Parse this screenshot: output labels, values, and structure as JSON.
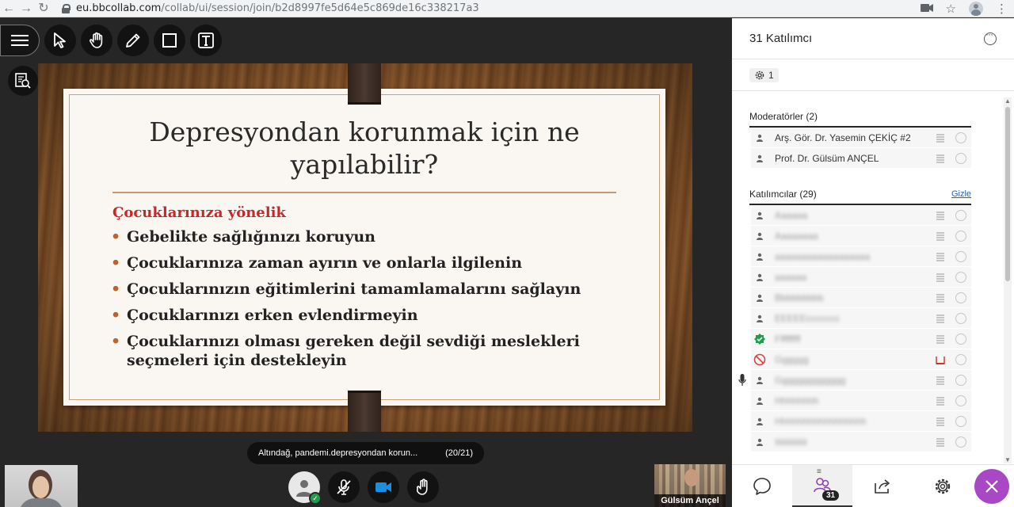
{
  "browser": {
    "url_domain": "eu.bbcollab.com",
    "url_path": "/collab/ui/session/join/b2d8997fe5d64e5c869de16c338217a3"
  },
  "slide": {
    "title": "Depresyondan korunmak için ne yapılabilir?",
    "subtitle": "Çocuklarınıza yönelik",
    "bullets": [
      "Gebelikte sağlığınızı koruyun",
      "Çocuklarınıza zaman ayırın ve onlarla ilgilenin",
      "Çocuklarınızın eğitimlerini tamamlamalarını sağlayın",
      "Çocuklarınızı erken evlendirmeyin",
      "Çocuklarınızı olması gereken değil sevdiği meslekleri seçmeleri için destekleyin"
    ]
  },
  "file": {
    "name": "Altındağ, pandemi.depresyondan korun...",
    "page": "(20/21)"
  },
  "speaker": {
    "name": "Gülsüm Ançel"
  },
  "panel": {
    "title": "31 Katılımcı",
    "filter_count": "1",
    "moderators_header": "Moderatörler (2)",
    "moderators": [
      "Arş. Gör. Dr. Yasemin ÇEKİÇ #2",
      "Prof. Dr. Gülsüm ANÇEL"
    ],
    "participants_header": "Katılımcılar (29)",
    "hide_label": "Gizle",
    "participants": [
      {
        "name": "Aaaaaa",
        "status": "person"
      },
      {
        "name": "Aaaaaaaa",
        "status": "person"
      },
      {
        "name": "aaaaaaaaaaaaaaaaaa",
        "status": "person"
      },
      {
        "name": "aaaaaa",
        "status": "person"
      },
      {
        "name": "Bbbbbbbbb",
        "status": "person"
      },
      {
        "name": "EEEEEccccccc",
        "status": "person"
      },
      {
        "name": "Fffffffff",
        "status": "present"
      },
      {
        "name": "Gggggg",
        "status": "away"
      },
      {
        "name": "Ggggggggggggg",
        "status": "person"
      },
      {
        "name": "Hhhhhhhh",
        "status": "person"
      },
      {
        "name": "Hhhhhhhhhhhhhhhhh",
        "status": "person"
      },
      {
        "name": "Iiiiiiiiiiiiiii",
        "status": "person"
      }
    ],
    "nav_badge": "31"
  },
  "colors": {
    "accent": "#a848c4",
    "present": "#1f9e4a",
    "away": "#d64545"
  }
}
